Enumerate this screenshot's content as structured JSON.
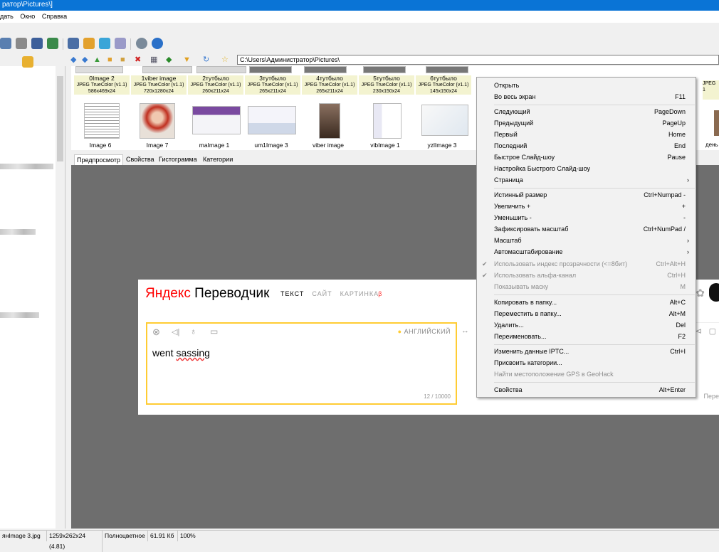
{
  "window": {
    "title": "ратор\\Pictures\\]"
  },
  "menubar": {
    "items": [
      "дать",
      "Окно",
      "Справка"
    ]
  },
  "navbar": {
    "address": "C:\\Users\\Администратор\\Pictures\\"
  },
  "thumbnails_top": [
    {
      "name": "0Image 2",
      "format": "JPEG TrueColor (v1.1)",
      "size": "586x469x24"
    },
    {
      "name": "1viber image",
      "format": "JPEG TrueColor (v1.1)",
      "size": "720x1280x24"
    },
    {
      "name": "2тутбыло",
      "format": "JPEG TrueColor (v1.1)",
      "size": "260x211x24"
    },
    {
      "name": "3тутбыло",
      "format": "JPEG TrueColor (v1.1)",
      "size": "265x211x24"
    },
    {
      "name": "4тутбыло",
      "format": "JPEG TrueColor (v1.1)",
      "size": "265x211x24"
    },
    {
      "name": "5тутбыло",
      "format": "JPEG TrueColor (v1.1)",
      "size": "230x150x24"
    },
    {
      "name": "6тутбыло",
      "format": "JPEG TrueColor (v1.1)",
      "size": "145x150x24"
    }
  ],
  "thumbnails_bottom": [
    "Image 6",
    "Image 7",
    "maImage 1",
    "um1Image 3",
    "viber image",
    "vibImage 1",
    "yzlImage 3"
  ],
  "right_edge": {
    "partial_label": "JPEG",
    "partial_size": "1",
    "partial_name": "день"
  },
  "tabs": [
    "Предпросмотр",
    "Свойства",
    "Гистограмма",
    "Категории"
  ],
  "yandex": {
    "logo_ya": "Яндекс",
    "logo_rest": " Переводчик",
    "nav": [
      "ТЕКСТ",
      "САЙТ",
      "КАРТИНКА"
    ],
    "beta": "β",
    "lang": "АНГЛИЙСКИЙ",
    "text_plain": "went ",
    "text_error": "sassing",
    "counter": "12 / 10000",
    "right_partial": "Пере"
  },
  "context_menu": {
    "items": [
      {
        "label": "Открыть",
        "shortcut": ""
      },
      {
        "label": "Во весь экран",
        "shortcut": "F11"
      },
      {
        "label": "Следующий",
        "shortcut": "PageDown"
      },
      {
        "label": "Предыдущий",
        "shortcut": "PageUp"
      },
      {
        "label": "Первый",
        "shortcut": "Home"
      },
      {
        "label": "Последний",
        "shortcut": "End"
      },
      {
        "label": "Быстрое Слайд-шоу",
        "shortcut": "Pause"
      },
      {
        "label": "Настройка Быстрого Слайд-шоу",
        "shortcut": ""
      },
      {
        "label": "Страница",
        "shortcut": ""
      },
      {
        "label": "Истинный размер",
        "shortcut": "Ctrl+Numpad -"
      },
      {
        "label": "Увеличить +",
        "shortcut": "+"
      },
      {
        "label": "Уменьшить -",
        "shortcut": "-"
      },
      {
        "label": "Зафиксировать масштаб",
        "shortcut": "Ctrl+NumPad /"
      },
      {
        "label": "Масштаб",
        "shortcut": ""
      },
      {
        "label": "Автомасштабирование",
        "shortcut": ""
      },
      {
        "label": "Использовать индекс прозрачности (<=8бит)",
        "shortcut": "Ctrl+Alt+H"
      },
      {
        "label": "Использовать альфа-канал",
        "shortcut": "Ctrl+H"
      },
      {
        "label": "Показывать маску",
        "shortcut": "M"
      },
      {
        "label": "Копировать в папку...",
        "shortcut": "Alt+C"
      },
      {
        "label": "Переместить в папку...",
        "shortcut": "Alt+M"
      },
      {
        "label": "Удалить...",
        "shortcut": "Del"
      },
      {
        "label": "Переименовать...",
        "shortcut": "F2"
      },
      {
        "label": "Изменить данные IPTC...",
        "shortcut": "Ctrl+I"
      },
      {
        "label": "Присвоить категории...",
        "shortcut": ""
      },
      {
        "label": "Найти местоположение GPS в GeoHack",
        "shortcut": ""
      },
      {
        "label": "Свойства",
        "shortcut": "Alt+Enter"
      }
    ]
  },
  "statusbar": [
    "янImage 3.jpg",
    "1259x262x24 (4.81)",
    "Полноцветное",
    "61.91 Кб",
    "100%"
  ],
  "colors": {
    "title_bar": "#0a74d6",
    "yandex_red": "#ff0000",
    "input_border": "#ffcc33",
    "preview_bg": "#6e6e6e"
  }
}
